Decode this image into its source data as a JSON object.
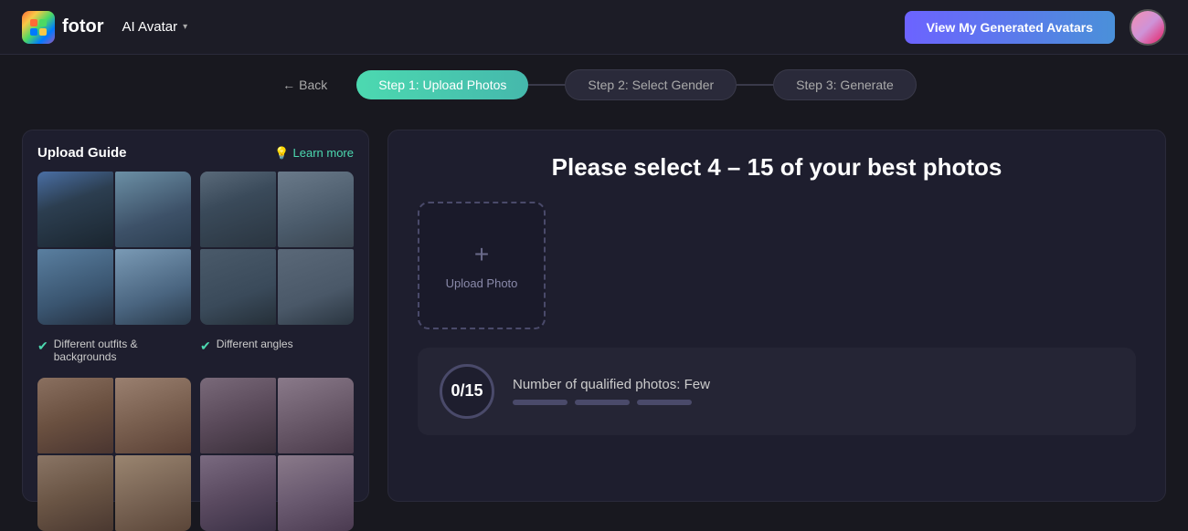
{
  "header": {
    "logo_text": "fotor",
    "ai_avatar_label": "AI Avatar",
    "view_avatars_label": "View My Generated Avatars"
  },
  "steps": {
    "step1": {
      "label": "Step 1: Upload Photos",
      "active": true
    },
    "step2": {
      "label": "Step 2: Select Gender",
      "active": false
    },
    "step3": {
      "label": "Step 3: Generate",
      "active": false
    }
  },
  "back_label": "Back",
  "upload_guide": {
    "title": "Upload Guide",
    "learn_more": "Learn more",
    "label1_line1": "Different outfits &",
    "label1_line2": "backgrounds",
    "label2": "Different angles"
  },
  "main_panel": {
    "title": "Please select 4 – 15 of your best photos",
    "upload_photo_label": "Upload Photo",
    "count_text": "0/15",
    "qualified_label": "Number of qualified photos: Few"
  },
  "icons": {
    "back": "←",
    "chevron_down": "▾",
    "lightbulb": "💡",
    "check": "✅",
    "plus": "+"
  }
}
